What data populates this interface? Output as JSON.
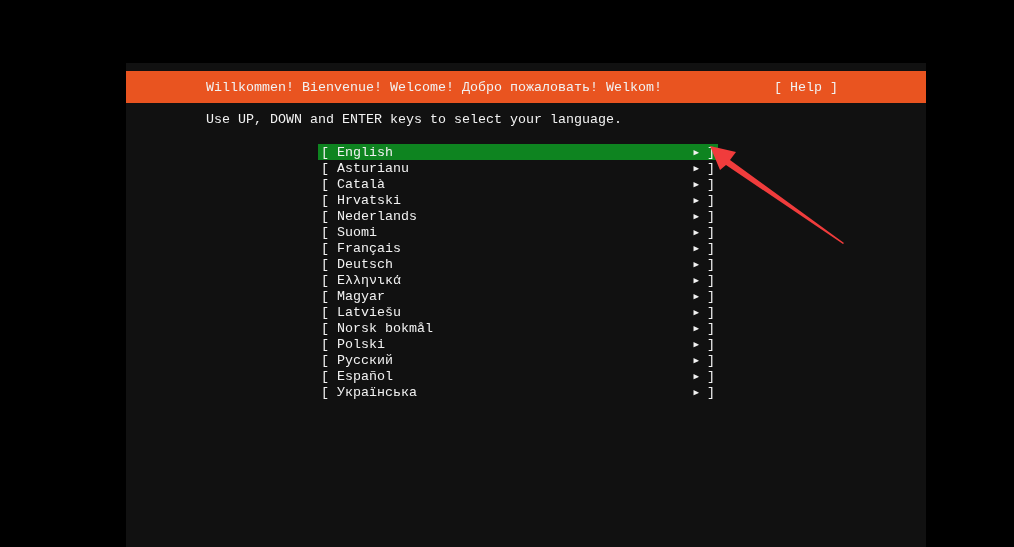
{
  "header": {
    "title": "Willkommen! Bienvenue! Welcome! Добро пожаловать! Welkom!",
    "help": "[ Help ]"
  },
  "instruction": "Use UP, DOWN and ENTER keys to select your language.",
  "languages": [
    {
      "open": "[",
      "label": "English",
      "arrow": "▶",
      "close": "]",
      "selected": true
    },
    {
      "open": "[",
      "label": "Asturianu",
      "arrow": "▶",
      "close": "]",
      "selected": false
    },
    {
      "open": "[",
      "label": "Català",
      "arrow": "▶",
      "close": "]",
      "selected": false
    },
    {
      "open": "[",
      "label": "Hrvatski",
      "arrow": "▶",
      "close": "]",
      "selected": false
    },
    {
      "open": "[",
      "label": "Nederlands",
      "arrow": "▶",
      "close": "]",
      "selected": false
    },
    {
      "open": "[",
      "label": "Suomi",
      "arrow": "▶",
      "close": "]",
      "selected": false
    },
    {
      "open": "[",
      "label": "Français",
      "arrow": "▶",
      "close": "]",
      "selected": false
    },
    {
      "open": "[",
      "label": "Deutsch",
      "arrow": "▶",
      "close": "]",
      "selected": false
    },
    {
      "open": "[",
      "label": "Ελληνικά",
      "arrow": "▶",
      "close": "]",
      "selected": false
    },
    {
      "open": "[",
      "label": "Magyar",
      "arrow": "▶",
      "close": "]",
      "selected": false
    },
    {
      "open": "[",
      "label": "Latviešu",
      "arrow": "▶",
      "close": "]",
      "selected": false
    },
    {
      "open": "[",
      "label": "Norsk bokmål",
      "arrow": "▶",
      "close": "]",
      "selected": false
    },
    {
      "open": "[",
      "label": "Polski",
      "arrow": "▶",
      "close": "]",
      "selected": false
    },
    {
      "open": "[",
      "label": "Русский",
      "arrow": "▶",
      "close": "]",
      "selected": false
    },
    {
      "open": "[",
      "label": "Español",
      "arrow": "▶",
      "close": "]",
      "selected": false
    },
    {
      "open": "[",
      "label": "Українська",
      "arrow": "▶",
      "close": "]",
      "selected": false
    }
  ]
}
